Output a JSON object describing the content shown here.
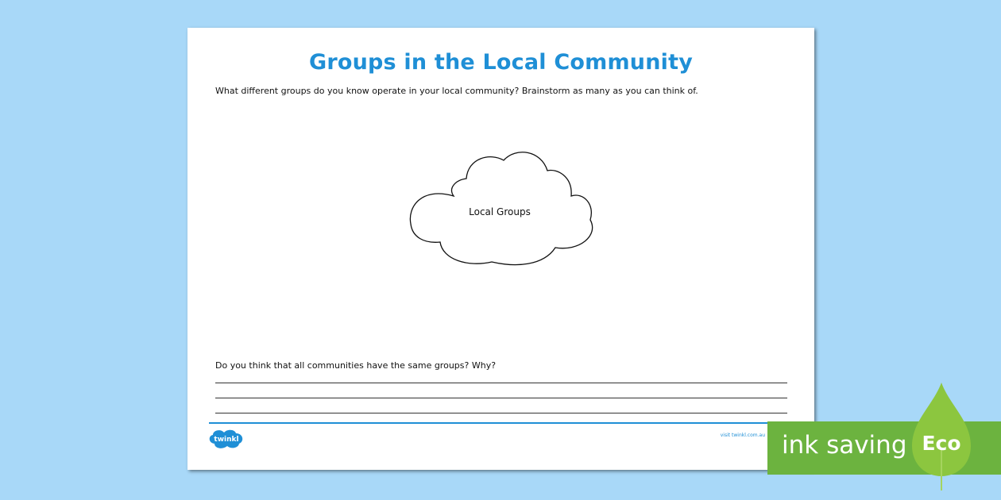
{
  "worksheet": {
    "title": "Groups in the Local Community",
    "prompt": "What different groups do you know operate in your local community? Brainstorm as many as you can think of.",
    "cloud_label": "Local Groups",
    "question": "Do you think that all communities have the same groups? Why?",
    "answer_lines": 3
  },
  "footer": {
    "logo_text": "twinkl",
    "url": "visit twinkl.com.au"
  },
  "badge": {
    "text": "ink saving",
    "eco": "Eco"
  },
  "colors": {
    "background": "#a8d8f8",
    "title": "#1f8fd6",
    "badge_green": "#6cb33f",
    "leaf_green": "#8cc63f"
  }
}
